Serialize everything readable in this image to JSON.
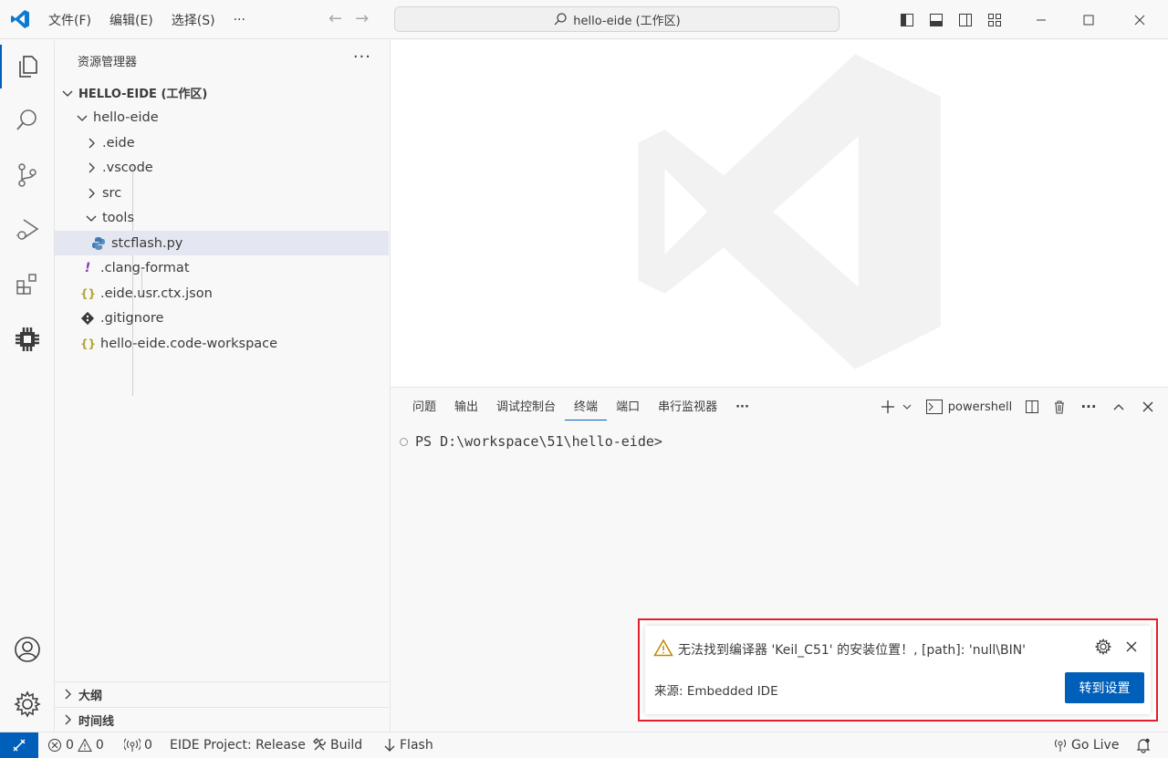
{
  "menu": {
    "file": "文件(F)",
    "edit": "编辑(E)",
    "select": "选择(S)",
    "more": "···"
  },
  "search": {
    "text": "hello-eide (工作区)"
  },
  "sidebar": {
    "title": "资源管理器",
    "more": "···",
    "tree": [
      {
        "label": "HELLO-EIDE (工作区)",
        "kind": "workspace"
      },
      {
        "label": "hello-eide",
        "kind": "folder-open"
      },
      {
        "label": ".eide",
        "kind": "folder"
      },
      {
        "label": ".vscode",
        "kind": "folder"
      },
      {
        "label": "src",
        "kind": "folder"
      },
      {
        "label": "tools",
        "kind": "folder-open"
      },
      {
        "label": "stcflash.py",
        "kind": "python"
      },
      {
        "label": ".clang-format",
        "kind": "config"
      },
      {
        "label": ".eide.usr.ctx.json",
        "kind": "json"
      },
      {
        "label": ".gitignore",
        "kind": "git"
      },
      {
        "label": "hello-eide.code-workspace",
        "kind": "json"
      }
    ],
    "outline": "大纲",
    "timeline": "时间线"
  },
  "panel": {
    "tabs": [
      "问题",
      "输出",
      "调试控制台",
      "终端",
      "端口",
      "串行监视器"
    ],
    "active_tab": "终端",
    "more": "···",
    "terminal_name": "powershell",
    "prompt": "PS D:\\workspace\\51\\hello-eide>"
  },
  "notification": {
    "message": "无法找到编译器 'Keil_C51' 的安装位置！, [path]: 'null\\BIN'",
    "source": "来源: Embedded IDE",
    "action": "转到设置"
  },
  "statusbar": {
    "errors": "0",
    "warnings": "0",
    "ports": "0",
    "project": "EIDE Project: Release",
    "build": "Build",
    "flash": "Flash",
    "golive": "Go Live"
  },
  "colors": {
    "accent": "#005fb8",
    "highlight_border": "#e0202a",
    "warning": "#bf8803"
  }
}
